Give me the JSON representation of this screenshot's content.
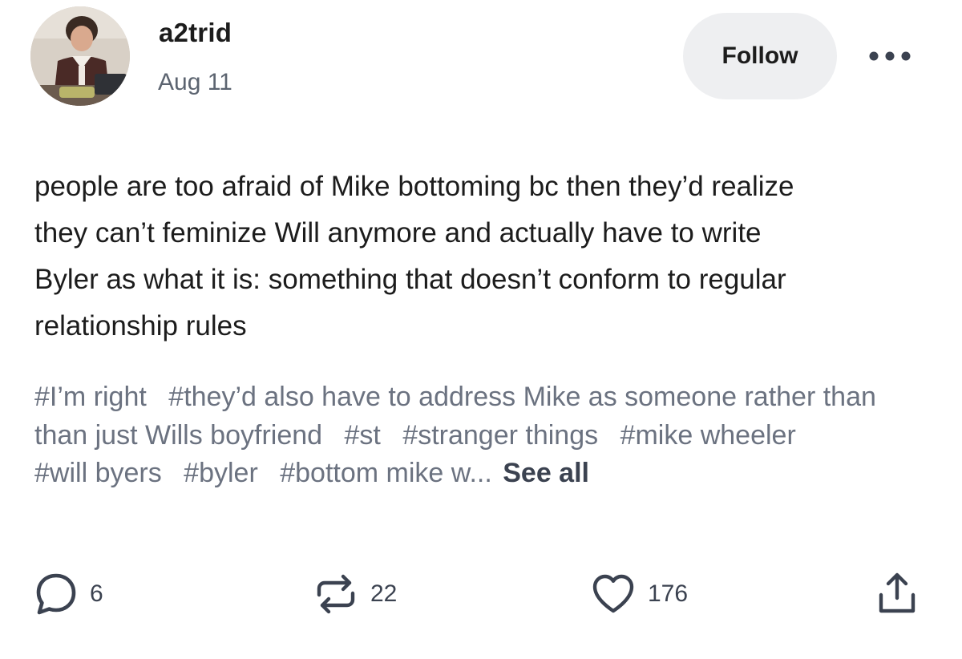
{
  "post": {
    "username": "a2trid",
    "date": "Aug 11",
    "follow_label": "Follow",
    "text_lines": [
      "people are too afraid of Mike bottoming bc then they’d realize",
      "they can’t feminize Will anymore and actually have to write",
      "Byler as what it is: something that doesn’t conform to regular",
      "relationship rules"
    ],
    "tags": [
      "#I’m right",
      "#they’d also have to address Mike as someone rather than than just Wills boyfriend",
      "#st",
      "#stranger things",
      "#mike wheeler",
      "#will byers",
      "#byler",
      "#bottom mike w..."
    ],
    "see_all_label": "See all"
  },
  "actions": {
    "comments": "6",
    "reblogs": "22",
    "likes": "176"
  },
  "icons": {
    "more": "more-horizontal-icon",
    "comment": "comment-bubble-icon",
    "reblog": "reblog-icon",
    "like": "heart-icon",
    "share": "share-icon"
  },
  "colors": {
    "text": "#1c1c1c",
    "muted": "#5c6470",
    "tags": "#6b7280",
    "button_bg": "#eeeff1"
  }
}
